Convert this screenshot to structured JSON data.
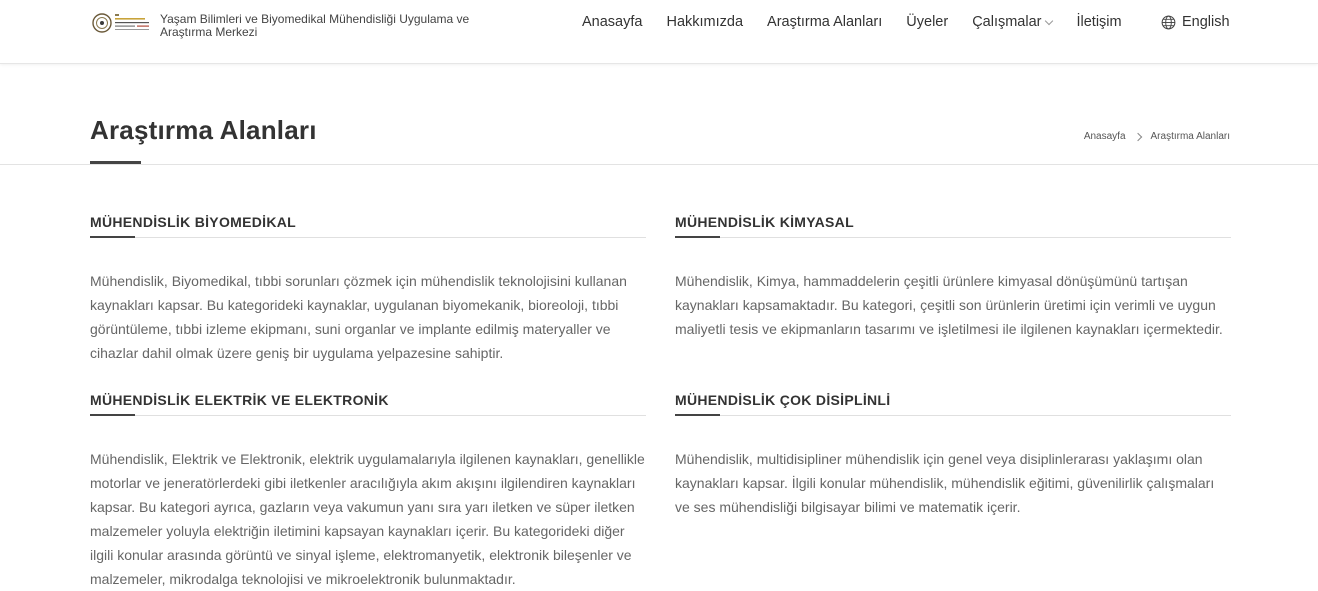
{
  "header": {
    "org_name": "Yaşam Bilimleri ve Biyomedikal Mühendisliği Uygulama ve Araştırma Merkezi",
    "nav": [
      {
        "label": "Anasayfa"
      },
      {
        "label": "Hakkımızda"
      },
      {
        "label": "Araştırma Alanları"
      },
      {
        "label": "Üyeler"
      },
      {
        "label": "Çalışmalar"
      },
      {
        "label": "İletişim"
      }
    ],
    "language": "English",
    "icons": {
      "logo": "university-logo",
      "language": "globe-icon",
      "dropdown": "chevron-down-icon"
    }
  },
  "page": {
    "title": "Araştırma Alanları",
    "breadcrumb": [
      {
        "label": "Anasayfa"
      },
      {
        "label": "Araştırma Alanları"
      }
    ]
  },
  "areas": [
    {
      "heading": "MÜHENDİSLİK BİYOMEDİKAL",
      "text": "Mühendislik, Biyomedikal, tıbbi sorunları çözmek için mühendislik teknolojisini kullanan kaynakları kapsar. Bu kategorideki kaynaklar, uygulanan biyomekanik, bioreoloji, tıbbi görüntüleme, tıbbi izleme ekipmanı, suni organlar ve implante edilmiş materyaller ve cihazlar dahil olmak üzere geniş bir uygulama yelpazesine sahiptir."
    },
    {
      "heading": "MÜHENDİSLİK KİMYASAL",
      "text": "Mühendislik, Kimya, hammaddelerin çeşitli ürünlere kimyasal dönüşümünü tartışan kaynakları kapsamaktadır. Bu kategori, çeşitli son ürünlerin üretimi için verimli ve uygun maliyetli tesis ve ekipmanların tasarımı ve işletilmesi ile ilgilenen kaynakları içermektedir."
    },
    {
      "heading": "MÜHENDİSLİK ELEKTRİK VE ELEKTRONİK",
      "text": "Mühendislik, Elektrik ve Elektronik, elektrik uygulamalarıyla ilgilenen kaynakları, genellikle motorlar ve jeneratörlerdeki gibi iletkenler aracılığıyla akım akışını ilgilendiren kaynakları kapsar. Bu kategori ayrıca, gazların veya vakumun yanı sıra yarı iletken ve süper iletken malzemeler yoluyla elektriğin iletimini kapsayan kaynakları içerir. Bu kategorideki diğer ilgili konular arasında görüntü ve sinyal işleme, elektromanyetik, elektronik bileşenler ve malzemeler, mikrodalga teknolojisi ve mikroelektronik bulunmaktadır."
    },
    {
      "heading": "MÜHENDİSLİK ÇOK DİSİPLİNLİ",
      "text": "Mühendislik, multidisipliner mühendislik için genel veya disiplinlerarası yaklaşımı olan kaynakları kapsar. İlgili konular mühendislik, mühendislik eğitimi, güvenilirlik çalışmaları ve ses mühendisliği bilgisayar bilimi ve matematik içerir."
    }
  ]
}
